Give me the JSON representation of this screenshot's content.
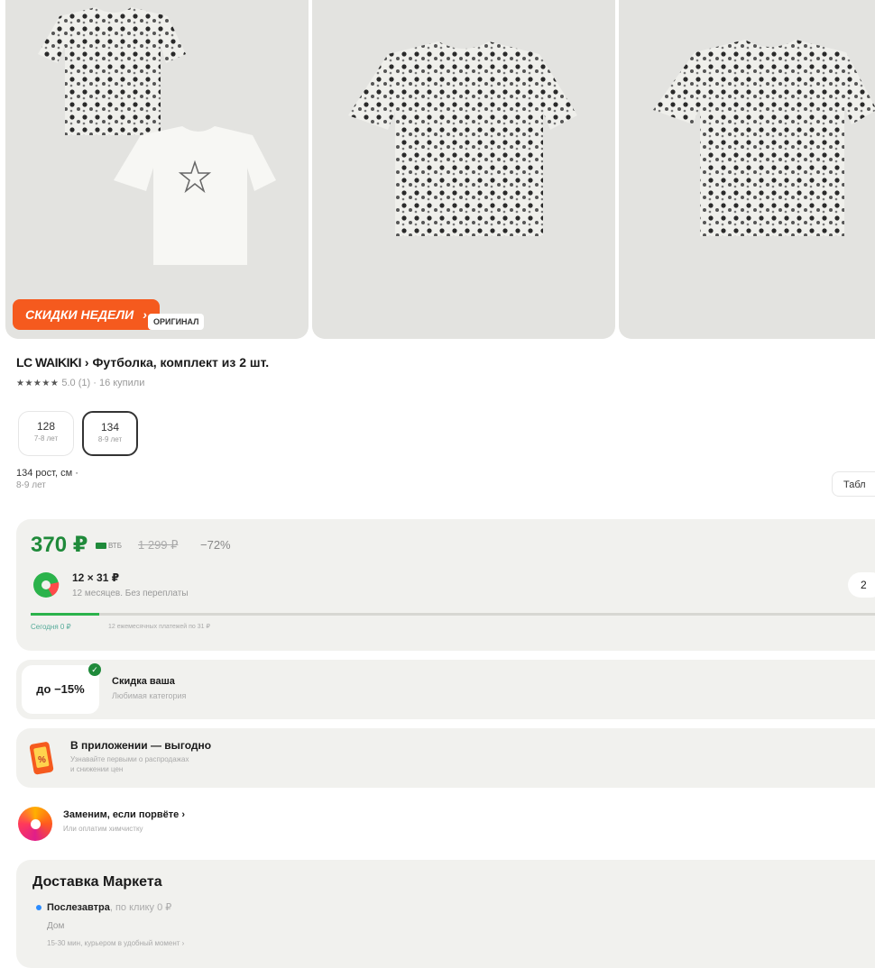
{
  "gallery": {
    "sale_badge": "СКИДКИ НЕДЕЛИ",
    "sale_arrow": "›",
    "original_badge": "ОРИГИНАЛ"
  },
  "product": {
    "brand": "LC WAIKIKI",
    "sep": " › ",
    "name": "Футболка, комплект из 2 шт.",
    "stars": "★★★★★",
    "rating_text": " 5.0 (1) · 16 купили"
  },
  "sizes": [
    {
      "size": "128",
      "age": "7-8 лет",
      "selected": false
    },
    {
      "size": "134",
      "age": "8-9 лет",
      "selected": true
    }
  ],
  "size_info": {
    "line1": "134 рост, см ·",
    "line2": "8-9 лет"
  },
  "size_table_link": "Табл",
  "price": {
    "current": "370 ₽",
    "vtb": "ВТБ",
    "old": "1 299 ₽",
    "discount": "−72%",
    "split_amount": "12 × 31 ₽",
    "split_sub": "12 месяцев. Без переплаты",
    "split_pill": "2",
    "progress": 0.08,
    "today": "Сегодня 0 ₽",
    "payments": "12 ежемесячных платежей по 31 ₽"
  },
  "discount_card": {
    "badge": "до −15%",
    "title": "Скидка ваша",
    "sub": "Любимая категория"
  },
  "app_card": {
    "title": "В приложении — выгодно",
    "sub1": "Узнавайте первыми о распродажах",
    "sub2": "и снижении цен"
  },
  "replace_card": {
    "title": "Заменим, если порвёте ›",
    "sub": "Или оплатим химчистку"
  },
  "delivery": {
    "title": "Доставка Маркета",
    "option_bold": "Послезавтра",
    "option_rest": ", по клику 0 ₽",
    "place": "Дом",
    "time": "15-30 мин, курьером в удобный момент ›"
  },
  "colors": {
    "price_green": "#1f8a3a",
    "sale_orange": "#f55a1e",
    "card_bg": "#f1f1ee"
  }
}
